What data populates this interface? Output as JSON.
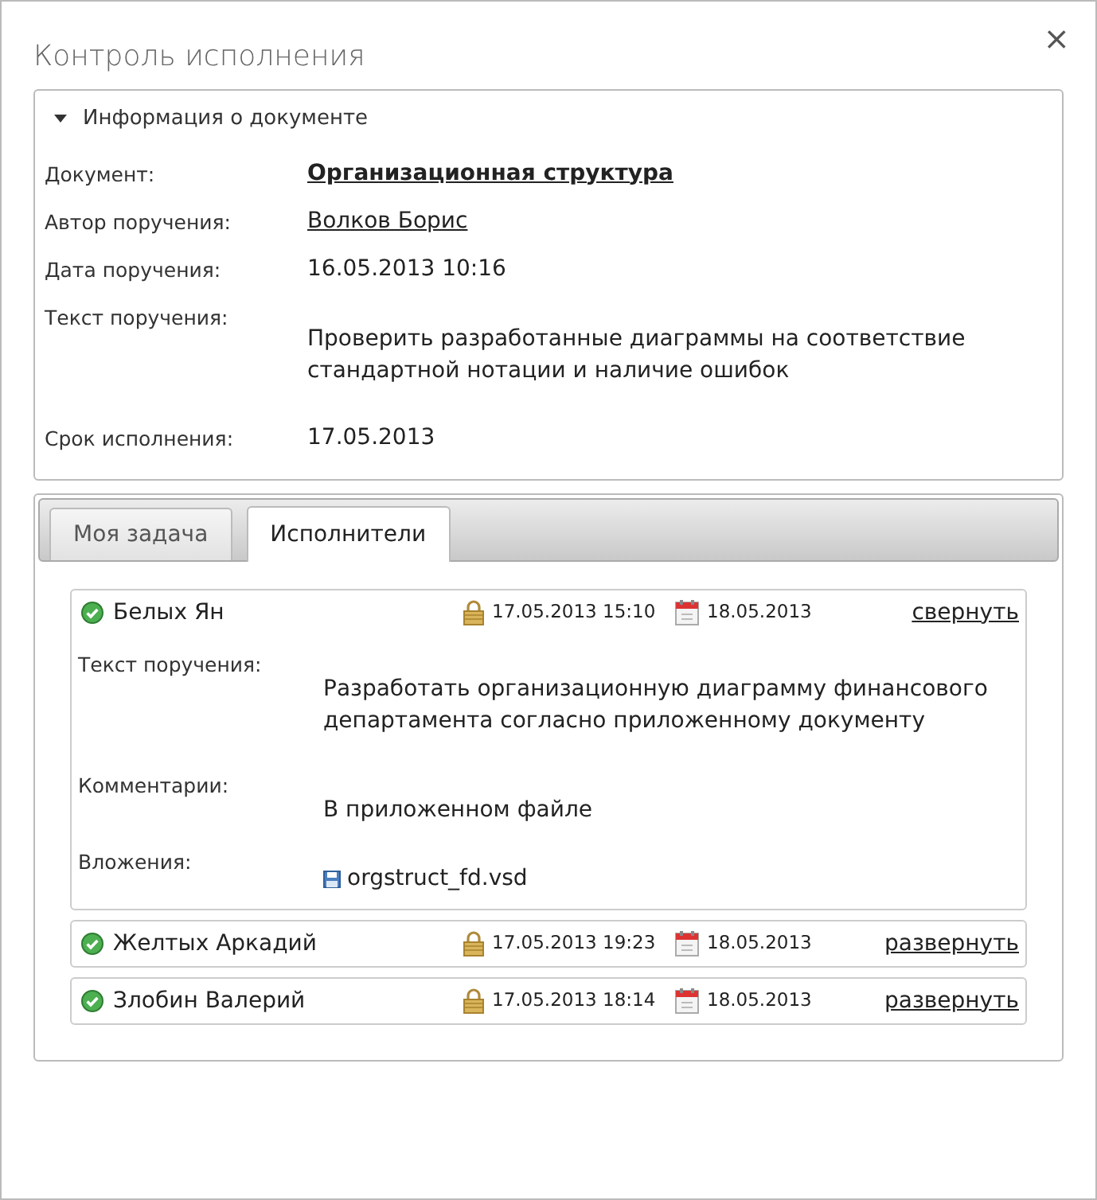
{
  "dialog": {
    "title": "Контроль исполнения",
    "close": "×"
  },
  "document_info": {
    "title": "Информация о документе",
    "expanded": true,
    "fields": [
      {
        "label": "Документ:",
        "value": "Организационная структура",
        "kind": "primary-link"
      },
      {
        "label": "Автор поручения:",
        "value": "Волков Борис",
        "kind": "link"
      },
      {
        "label": "Дата поручения:",
        "value": "16.05.2013 10:16",
        "kind": "text"
      },
      {
        "label": "Текст поручения:",
        "value": "Проверить разработанные диаграммы на соответствие стандартной нотации и наличие ошибок",
        "kind": "paragraph"
      },
      {
        "label": "Срок исполнения:",
        "value": "17.05.2013",
        "kind": "text"
      }
    ]
  },
  "tabs": [
    {
      "label": "Моя задача",
      "selected": false
    },
    {
      "label": "Исполнители",
      "selected": true
    }
  ],
  "executors": [
    {
      "name": "Белых Ян",
      "started": "17.05.2013 15:10",
      "due": "18.05.2013",
      "toggle": "свернуть",
      "expanded": true,
      "details": [
        {
          "label": "Текст поручения:",
          "value": "Разработать организационную диаграмму финансового департамента согласно приложенному документу",
          "kind": "paragraph"
        },
        {
          "label": "Комментарии:",
          "value": "В приложенном файле",
          "kind": "paragraph"
        },
        {
          "label": "Вложения:",
          "value": "orgstruct_fd.vsd",
          "kind": "attachment"
        }
      ]
    },
    {
      "name": "Желтых Аркадий",
      "started": "17.05.2013 19:23",
      "due": "18.05.2013",
      "toggle": "развернуть",
      "expanded": false
    },
    {
      "name": "Злобин Валерий",
      "started": "17.05.2013 18:14",
      "due": "18.05.2013",
      "toggle": "развернуть",
      "expanded": false
    }
  ]
}
